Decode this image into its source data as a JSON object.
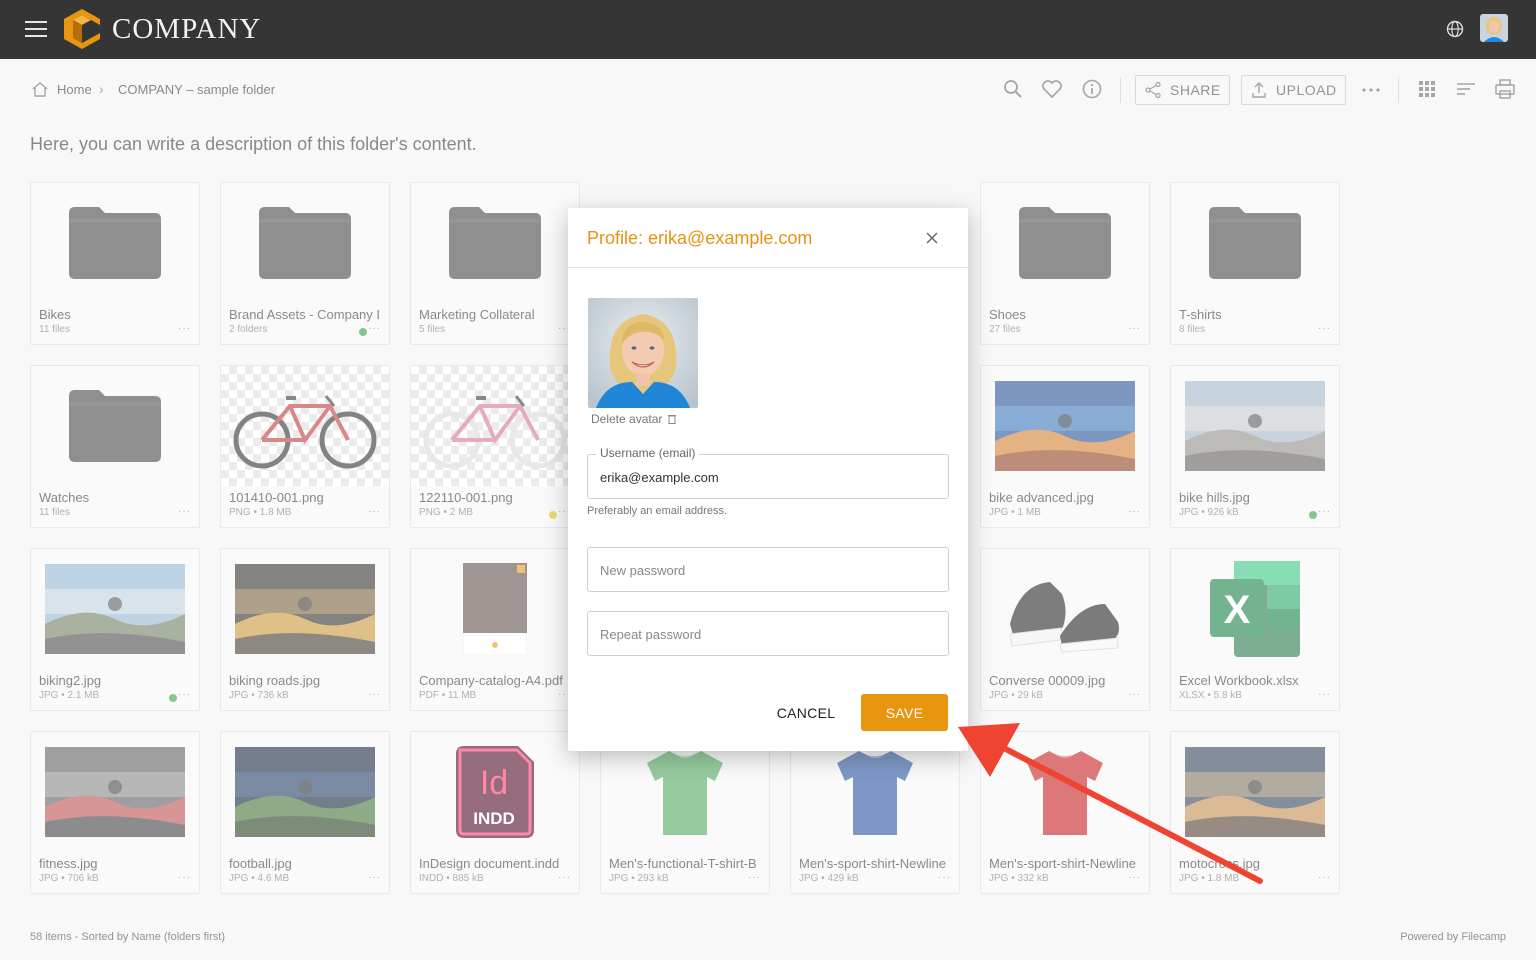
{
  "header": {
    "logo_text": "COMPANY"
  },
  "breadcrumb": {
    "home": "Home",
    "separator": "›",
    "folder": "COMPANY – sample folder"
  },
  "toolbar": {
    "share_label": "SHARE",
    "upload_label": "UPLOAD"
  },
  "description": "Here, you can write a description of this folder's content.",
  "items": [
    {
      "name": "Bikes",
      "meta": "11 files",
      "kind": "folder",
      "more": "···"
    },
    {
      "name": "Brand Assets - Company I",
      "meta": "2 folders",
      "kind": "folder",
      "more": "···",
      "dot": "#2e9b3e"
    },
    {
      "name": "Marketing Collateral",
      "meta": "5 files",
      "kind": "folder",
      "more": "···"
    },
    {
      "name": "",
      "meta": "",
      "kind": "hidden",
      "more": ""
    },
    {
      "name": "",
      "meta": "",
      "kind": "hidden",
      "more": ""
    },
    {
      "name": "Shoes",
      "meta": "27 files",
      "kind": "folder",
      "more": "···"
    },
    {
      "name": "T-shirts",
      "meta": "8 files",
      "kind": "folder",
      "more": "···"
    },
    {
      "name": "Watches",
      "meta": "11 files",
      "kind": "folder",
      "more": "···"
    },
    {
      "name": "101410-001.png",
      "meta": "PNG • 1.8 MB",
      "kind": "bike-dark",
      "more": "···"
    },
    {
      "name": "122110-001.png",
      "meta": "PNG • 2 MB",
      "kind": "bike-pink",
      "more": "···",
      "dot": "#e6b800"
    },
    {
      "name": "",
      "meta": "",
      "kind": "hidden",
      "more": ""
    },
    {
      "name": "",
      "meta": "",
      "kind": "hidden",
      "more": ""
    },
    {
      "name": "bike advanced.jpg",
      "meta": "JPG • 1 MB",
      "kind": "photo-desert",
      "more": "···"
    },
    {
      "name": "bike hills.jpg",
      "meta": "JPG • 926 kB",
      "kind": "photo-rock",
      "more": "···",
      "dot": "#2e9b3e"
    },
    {
      "name": "biking2.jpg",
      "meta": "JPG • 2.1 MB",
      "kind": "photo-road",
      "more": "···",
      "dot": "#2e9b3e"
    },
    {
      "name": "biking roads.jpg",
      "meta": "JPG • 736 kB",
      "kind": "photo-sunset",
      "more": "···"
    },
    {
      "name": "Company-catalog-A4.pdf",
      "meta": "PDF • 11 MB",
      "kind": "pdf",
      "more": "···"
    },
    {
      "name": "",
      "meta": "",
      "kind": "hidden",
      "more": ""
    },
    {
      "name": "",
      "meta": "",
      "kind": "hidden",
      "more": ""
    },
    {
      "name": "Converse 00009.jpg",
      "meta": "JPG • 29 kB",
      "kind": "shoes",
      "more": "···"
    },
    {
      "name": "Excel Workbook.xlsx",
      "meta": "XLSX • 5.8 kB",
      "kind": "excel",
      "more": "···"
    },
    {
      "name": "fitness.jpg",
      "meta": "JPG • 706 kB",
      "kind": "photo-gym",
      "more": "···"
    },
    {
      "name": "football.jpg",
      "meta": "JPG • 4.6 MB",
      "kind": "photo-stadium",
      "more": "···"
    },
    {
      "name": "InDesign document.indd",
      "meta": "INDD • 885 kB",
      "kind": "indd",
      "more": "···"
    },
    {
      "name": "Men's-functional-T-shirt-B",
      "meta": "JPG • 293 kB",
      "kind": "shirt-green",
      "more": "···"
    },
    {
      "name": "Men's-sport-shirt-Newline",
      "meta": "JPG • 429 kB",
      "kind": "shirt-blue",
      "more": "···"
    },
    {
      "name": "Men's-sport-shirt-Newline",
      "meta": "JPG • 332 kB",
      "kind": "shirt-red",
      "more": "···"
    },
    {
      "name": "motocross.jpg",
      "meta": "JPG • 1.8 MB",
      "kind": "photo-moto",
      "more": "···"
    }
  ],
  "footer": {
    "status": "58 items - Sorted by Name (folders first)",
    "powered": "Powered by Filecamp"
  },
  "modal": {
    "title": "Profile: erika@example.com",
    "delete_avatar": "Delete avatar",
    "username_label": "Username (email)",
    "username_value": "erika@example.com",
    "username_hint": "Preferably an email address.",
    "new_password_placeholder": "New password",
    "repeat_password_placeholder": "Repeat password",
    "cancel_label": "CANCEL",
    "save_label": "SAVE"
  },
  "icons": {
    "indd_letters": "Id",
    "indd_label": "INDD",
    "excel_letter": "X"
  },
  "colors": {
    "accent": "#e8950f",
    "topbar": "#353535",
    "arrow": "#ee4431"
  }
}
